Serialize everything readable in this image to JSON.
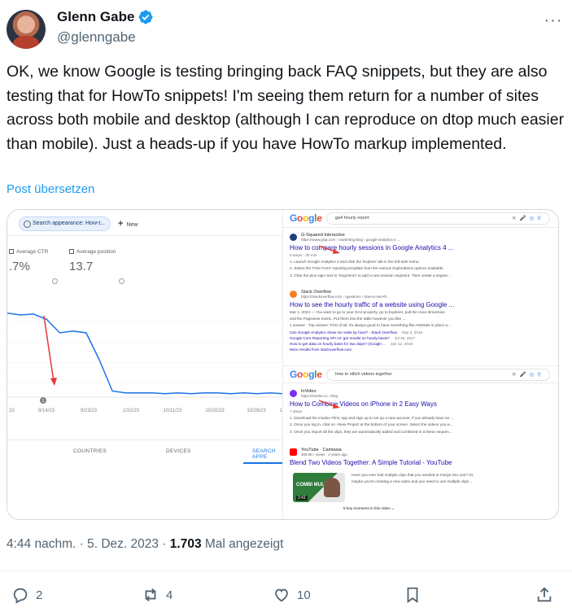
{
  "author": {
    "name": "Glenn Gabe",
    "handle": "@glenngabe"
  },
  "tweet": {
    "text": "OK, we know Google is testing bringing back FAQ snippets, but they are also testing that for HowTo snippets! I'm seeing them return for a number of sites across both mobile and desktop (although I can reproduce on dtop much easier than mobile). Just a heads-up if you have HowTo markup implemented.",
    "translate_label": "Post übersetzen"
  },
  "search_console": {
    "filter_chip": "Search appearance: How-t...",
    "new_label": "New",
    "metrics": [
      {
        "label": "Average CTR",
        "value": ".7%"
      },
      {
        "label": "Average position",
        "value": "13.7"
      }
    ],
    "chart_data": {
      "type": "line",
      "title": "",
      "x_tick_labels": [
        "23",
        "9/14/23",
        "9/23/23",
        "10/2/23",
        "10/11/23",
        "10/20/23",
        "10/29/23",
        "1"
      ],
      "annotation_marker": "1",
      "series": [
        {
          "values": [
            0.92,
            0.9,
            0.91,
            0.85,
            0.7,
            0.72,
            0.7,
            0.4,
            0.05,
            0.03,
            0.03,
            0.03,
            0.02,
            0.03,
            0.02,
            0.03,
            0.03,
            0.02,
            0.03,
            0.02,
            0.03,
            0.02
          ]
        }
      ],
      "line_color": "#1a73e8",
      "arrow_color": "#e53935"
    },
    "tabs": [
      "COUNTRIES",
      "DEVICES",
      "SEARCH APPE"
    ]
  },
  "serp_top": {
    "query": "ga4 hourly report",
    "results": [
      {
        "site": "G-Squared Interactive",
        "url": "https://www.gsqi.com › marketing-blog › google-analytics-4 ...",
        "title": "How to compare hourly sessions in Google Analytics 4 ...",
        "meta": "9 steps · 30 min",
        "lines": [
          "1.  Launch Google Analytics 4 and click the 'Explore' tab in the left-side menu.",
          "2.  Select the 'Free Form' reporting template from the various Explorations options available.",
          "3.  Click the plus sign next to 'Segments' to add a new session segment. Then create a segme..."
        ]
      },
      {
        "site": "Stack Overflow",
        "url": "https://stackoverflow.com › questions › how-to-see-th...",
        "title": "How to see the hourly traffic of a website using Google ...",
        "lines": [
          "Mar 1, 2023 — You want to go to your GA4 property, go to Explorer, pull the Hour dimension",
          "and the Pageview metric. Put them into the table however you like ...",
          "1 answer · Top answer: First of all, it's always good to have something like AWStats in place a..."
        ],
        "links": [
          {
            "text": "Can Google Analytics show me visits by hour? - Stack Overflow",
            "date": "Sep 3, 2016"
          },
          {
            "text": "Google Core Reporting API v4: get results on hourly basis?",
            "date": "Jul 25, 2017"
          },
          {
            "text": "How to get data on hourly basis for two days? (Google ...",
            "date": "Jan 12, 2019"
          },
          {
            "text": "More results from stackoverflow.com",
            "date": ""
          }
        ]
      }
    ]
  },
  "serp_bottom": {
    "query": "how to stitch videos together",
    "results": [
      {
        "site": "InVideo",
        "url": "https://invideo.io › blog",
        "title": "How to Combine Videos on iPhone in 2 Easy Ways",
        "meta": "7 steps",
        "lines": [
          "1.  Download the invideo Filmr App and sign up to set up a new account. If you already have an ...",
          "2.  Once you log in, click on +New Project at the bottom of your screen. Select the videos you w...",
          "3.  Once you import all the clips, they are automatically added and combined in a linear sequen..."
        ]
      },
      {
        "site": "YouTube · Camtasia",
        "url": "309.5K+ views · 2 years ago",
        "title": "Blend Two Videos Together: A Simple Tutorial - YouTube",
        "desc": [
          "Have you ever had multiple clips that you needed to merge into one? Or,",
          "maybe you're creating a new video and you need to use multiple clips ..."
        ],
        "thumb_text": "COMBI MULTIPLE",
        "thumb_duration": "2:41",
        "key_moments": "8 key moments in this video"
      }
    ]
  },
  "post_meta": {
    "time": "4:44 nachm.",
    "date": "5. Dez. 2023",
    "views_count": "1.703",
    "views_label": "Mal angezeigt"
  },
  "actions": {
    "replies": "2",
    "reposts": "4",
    "likes": "10"
  },
  "colors": {
    "link": "#1d9bf0",
    "verified": "#1d9bf0",
    "muted": "#536471"
  }
}
